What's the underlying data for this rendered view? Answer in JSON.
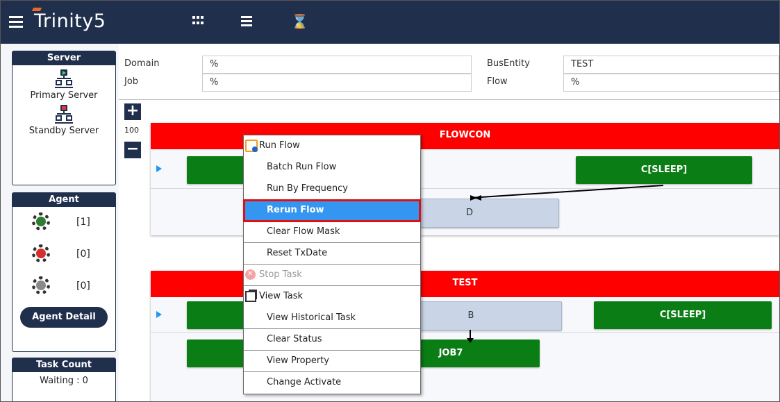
{
  "app": {
    "logo_text": "Trinity5"
  },
  "topbar": {
    "icons": [
      "menu-icon",
      "grid-icon",
      "list-icon",
      "hourglass-icon"
    ],
    "hourglass_glyph": "⌛"
  },
  "sidebar": {
    "server": {
      "title": "Server",
      "primary_label": "Primary Server",
      "standby_label": "Standby Server"
    },
    "agent": {
      "title": "Agent",
      "running_count": "[1]",
      "stopped_count": "[0]",
      "idle_count": "[0]",
      "detail_button": "Agent Detail"
    },
    "task_count": {
      "title": "Task Count",
      "waiting": "Waiting : 0"
    }
  },
  "filters": {
    "domain_label": "Domain",
    "domain_value": "%",
    "job_label": "Job",
    "job_value": "%",
    "busentity_label": "BusEntity",
    "busentity_value": "TEST",
    "flow_label": "Flow",
    "flow_value": "%"
  },
  "canvas": {
    "zoom_in": "+",
    "zoom_out": "−",
    "zoom_level": "100",
    "flows": [
      {
        "name": "FLOWCON",
        "row1_job_right": "C[SLEEP]",
        "row2_job": "D"
      },
      {
        "name": "TEST",
        "row1_job_mid": "B",
        "row1_job_right": "C[SLEEP]",
        "row2_job": "JOB7"
      }
    ]
  },
  "context_menu": {
    "items": [
      "Run Flow",
      "Batch Run Flow",
      "Run By Frequency",
      "Rerun Flow",
      "Clear Flow Mask",
      "Reset TxDate",
      "Stop Task",
      "View Task",
      "View Historical Task",
      "Clear Status",
      "View Property",
      "Change Activate"
    ],
    "highlighted": "Rerun Flow"
  },
  "colors": {
    "nav": "#1f2f4c",
    "flow_header": "#ff0000",
    "job_ok": "#0a7d14",
    "menu_highlight": "#3596f2",
    "highlight_border": "#e01010"
  }
}
